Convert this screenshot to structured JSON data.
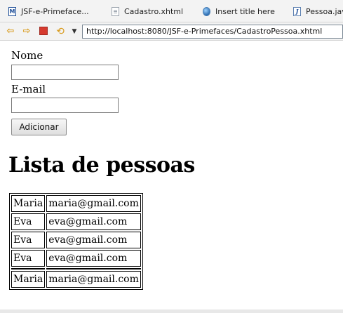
{
  "tabs": [
    {
      "label": "JSF-e-Primeface...",
      "icon": "xhtml-file-icon"
    },
    {
      "label": "Cadastro.xhtml",
      "icon": "page-file-icon"
    },
    {
      "label": "Insert title here",
      "icon": "globe-icon"
    },
    {
      "label": "Pessoa.java",
      "icon": "java-file-icon"
    }
  ],
  "toolbar": {
    "back_icon": "back-arrow-icon",
    "forward_icon": "forward-arrow-icon",
    "stop_icon": "stop-icon",
    "refresh_icon": "refresh-icon",
    "url": "http://localhost:8080/JSF-e-Primefaces/CadastroPessoa.xhtml"
  },
  "form": {
    "nome_label": "Nome",
    "nome_value": "",
    "email_label": "E-mail",
    "email_value": "",
    "submit_label": "Adicionar"
  },
  "list": {
    "title": "Lista de pessoas",
    "rows": [
      {
        "nome": "Maria",
        "email": "maria@gmail.com"
      },
      {
        "nome": "Eva",
        "email": "eva@gmail.com"
      },
      {
        "nome": "Eva",
        "email": "eva@gmail.com"
      },
      {
        "nome": "Eva",
        "email": "eva@gmail.com"
      },
      {
        "nome": "",
        "email": ""
      },
      {
        "nome": "Maria",
        "email": "maria@gmail.com"
      }
    ]
  }
}
